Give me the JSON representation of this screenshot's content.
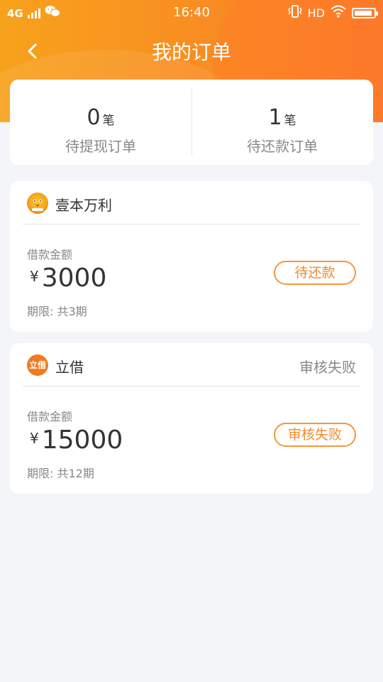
{
  "status_bar": {
    "network": "4G",
    "time": "16:40",
    "hd": "HD"
  },
  "nav": {
    "title": "我的订单"
  },
  "summary": {
    "withdraw_count": "0",
    "withdraw_unit": "笔",
    "withdraw_label": "待提现订单",
    "repay_count": "1",
    "repay_unit": "笔",
    "repay_label": "待还款订单"
  },
  "orders": [
    {
      "name": "壹本万利",
      "status_text": "",
      "amount_label": "借款金额",
      "currency": "¥",
      "amount": "3000",
      "term": "期限: 共3期",
      "button_label": "待还款"
    },
    {
      "name": "立借",
      "logo_text": "立借",
      "status_text": "审核失败",
      "amount_label": "借款金额",
      "currency": "¥",
      "amount": "15000",
      "term": "期限: 共12期",
      "button_label": "审核失败"
    }
  ],
  "colors": {
    "header_start": "#f7a21c",
    "header_end": "#fb7a2c",
    "accent": "#f08b2c",
    "background": "#f3f5f8"
  }
}
